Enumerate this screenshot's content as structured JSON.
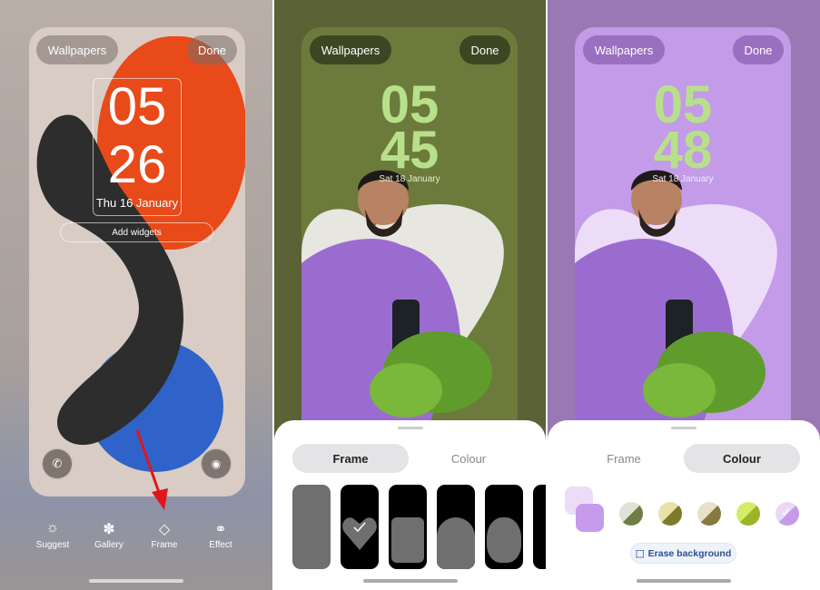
{
  "panel1": {
    "wallpapers": "Wallpapers",
    "done": "Done",
    "hour": "05",
    "minute": "26",
    "date": "Thu 16 January",
    "add_widgets": "Add widgets",
    "toolbar": [
      {
        "label": "Suggest",
        "icon": "lightbulb-icon"
      },
      {
        "label": "Gallery",
        "icon": "flower-icon"
      },
      {
        "label": "Frame",
        "icon": "frame-icon"
      },
      {
        "label": "Effect",
        "icon": "effect-icon"
      }
    ]
  },
  "panel2": {
    "wallpapers": "Wallpapers",
    "done": "Done",
    "hour": "05",
    "minute": "45",
    "date": "Sat 18 January",
    "tabs": {
      "frame": "Frame",
      "colour": "Colour"
    },
    "active_tab": "Frame",
    "selected_frame": "heart",
    "clock_color": "#b8e08a"
  },
  "panel3": {
    "wallpapers": "Wallpapers",
    "done": "Done",
    "hour": "05",
    "minute": "48",
    "date": "Sat 18 January",
    "tabs": {
      "frame": "Frame",
      "colour": "Colour"
    },
    "active_tab": "Colour",
    "erase_background": "Erase background",
    "swatches": [
      [
        "#dfe3d3",
        "#6e7d45"
      ],
      [
        "#e8e2a8",
        "#7e7a2c"
      ],
      [
        "#e9e0cc",
        "#867a3e"
      ],
      [
        "#d4ec6a",
        "#9ab52a"
      ],
      [
        "#ead8f7",
        "#c59ae8"
      ]
    ],
    "selected_swatch": 5,
    "selected_colors": [
      "#ecdcf8",
      "#c79bec"
    ]
  }
}
